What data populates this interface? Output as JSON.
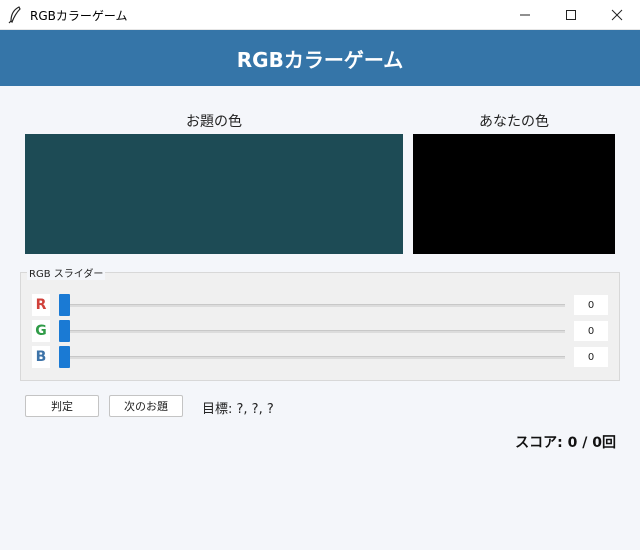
{
  "window": {
    "title": "RGBカラーゲーム"
  },
  "header": {
    "title": "RGBカラーゲーム"
  },
  "target_panel": {
    "label": "お題の色",
    "color": "#1d4b55"
  },
  "yours_panel": {
    "label": "あなたの色",
    "color": "#000000"
  },
  "sliders": {
    "legend": "RGB スライダー",
    "accent": "#1a7ad4",
    "channels": [
      {
        "label": "R",
        "value": "0",
        "color": "#d0413b"
      },
      {
        "label": "G",
        "value": "0",
        "color": "#2f9b47"
      },
      {
        "label": "B",
        "value": "0",
        "color": "#3d73a8"
      }
    ]
  },
  "actions": {
    "judge_label": "判定",
    "next_label": "次のお題"
  },
  "target_text": "目標: ?, ?, ?",
  "score_text": "スコア: 0 / 0回",
  "colors": {
    "header_bg": "#3575a8",
    "page_bg": "#f4f6fa"
  }
}
